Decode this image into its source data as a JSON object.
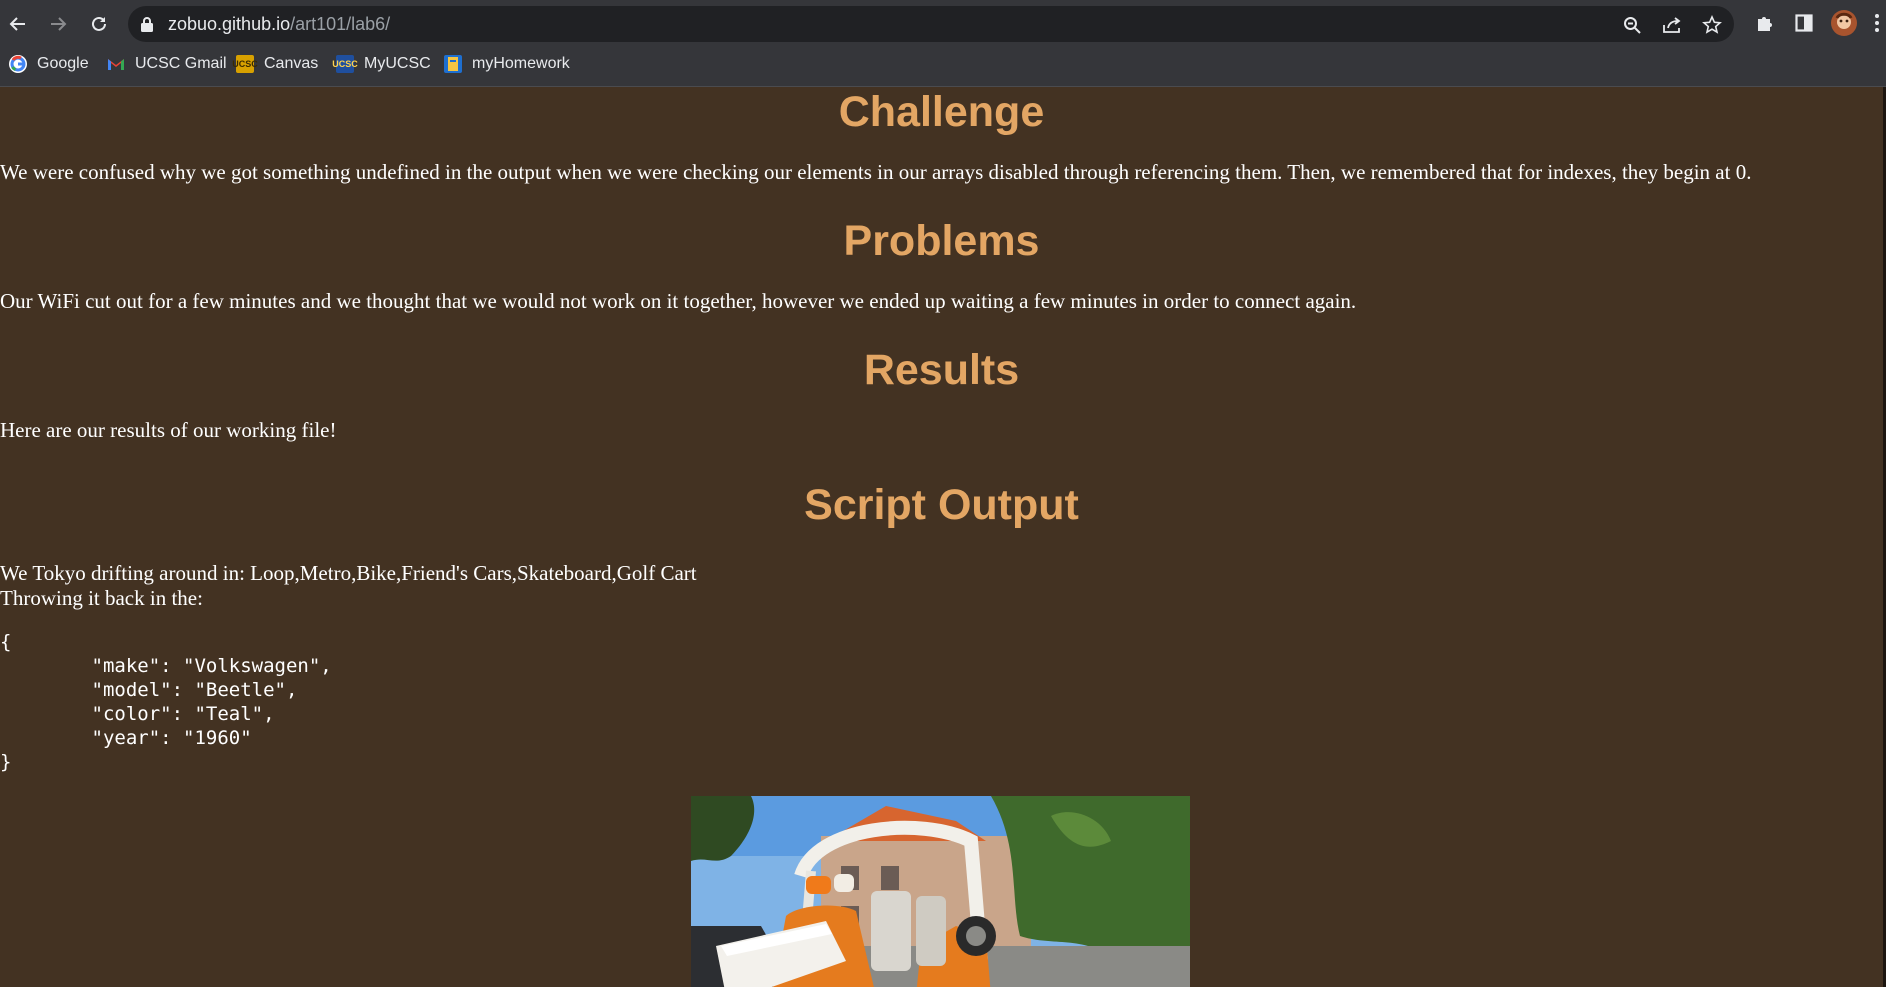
{
  "browser": {
    "url_host": "zobuo.github.io",
    "url_path": "/art101/lab6/",
    "bookmarks": [
      {
        "label": "Google",
        "icon": "google-icon"
      },
      {
        "label": "UCSC Gmail",
        "icon": "gmail-icon"
      },
      {
        "label": "Canvas",
        "icon": "canvas-icon"
      },
      {
        "label": "MyUCSC",
        "icon": "myucsc-icon"
      },
      {
        "label": "myHomework",
        "icon": "myhomework-icon"
      }
    ]
  },
  "sections": {
    "challenge": {
      "heading": "Challenge",
      "text": "We were confused why we got something undefined in the output when we were checking our elements in our arrays disabled through referencing them. Then, we remembered that for indexes, they begin at 0."
    },
    "problems": {
      "heading": "Problems",
      "text": "Our WiFi cut out for a few minutes and we thought that we would not work on it together, however we ended up waiting a few minutes in order to connect again."
    },
    "results": {
      "heading": "Results",
      "text": "Here are our results of our working file!"
    },
    "output": {
      "heading": "Script Output",
      "line1": "We Tokyo drifting around in: Loop,Metro,Bike,Friend's Cars,Skateboard,Golf Cart",
      "line2": "Throwing it back in the:",
      "code": "{\n        \"make\": \"Volkswagen\",\n        \"model\": \"Beetle\",\n        \"color\": \"Teal\",\n        \"year\": \"1960\"\n}"
    }
  },
  "colors": {
    "page_bg": "#433222",
    "heading": "#e3a664",
    "text": "#ffffff",
    "chrome_bg": "#35363a",
    "omnibox_bg": "#202124"
  }
}
